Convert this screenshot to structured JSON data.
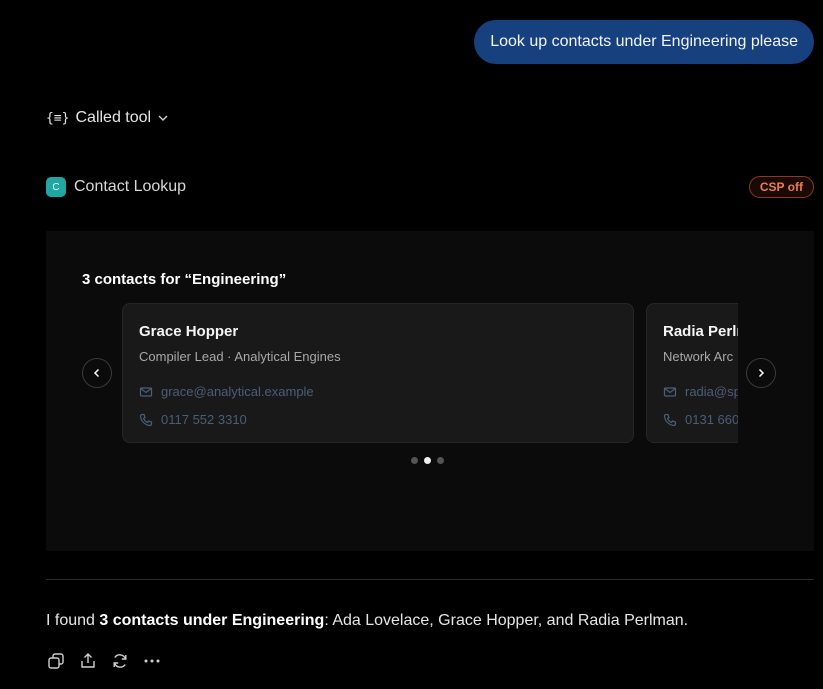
{
  "user_message": "Look up contacts under Engineering please",
  "tool_call": {
    "label": "Called tool",
    "icon": "braces-icon"
  },
  "tool": {
    "avatar_letter": "C",
    "name": "Contact Lookup",
    "csp_badge": "CSP off",
    "accent": "#1fa7a3"
  },
  "widget": {
    "title": "3 contacts for “Engineering”",
    "cards": [
      {
        "name": "Grace Hopper",
        "role": "Compiler Lead · Analytical Engines",
        "email": "grace@analytical.example",
        "phone": "0117 552 3310"
      },
      {
        "name": "Radia Perlı",
        "role": "Network Arc",
        "email": "radia@sp",
        "phone": "0131 660"
      }
    ],
    "pagination": {
      "total": 3,
      "active_index": 1
    }
  },
  "answer": {
    "prefix": "I found ",
    "bold": "3 contacts under Engineering",
    "suffix": ": Ada Lovelace, Grace Hopper, and Radia Perlman."
  },
  "actions": [
    "copy-icon",
    "share-icon",
    "regenerate-icon",
    "more-icon"
  ]
}
